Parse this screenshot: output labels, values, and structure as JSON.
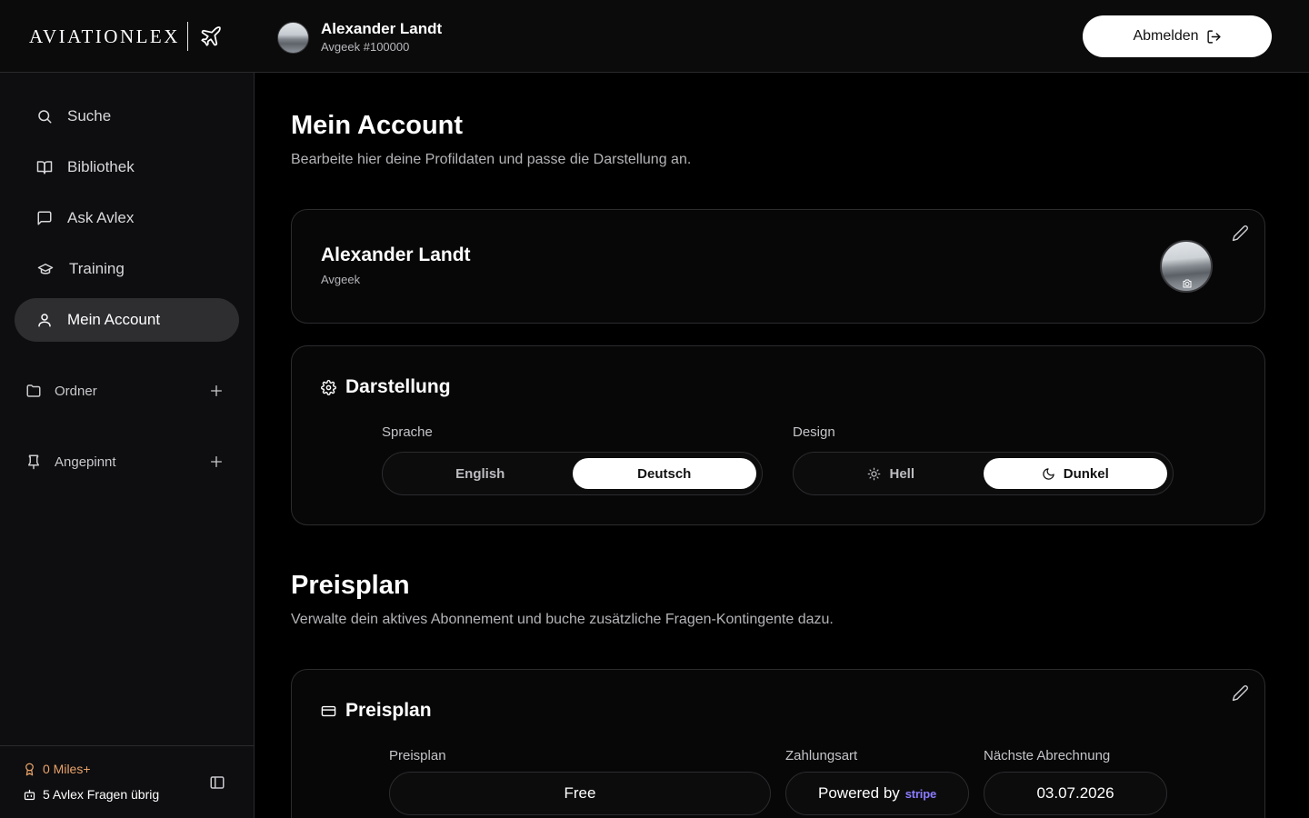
{
  "app": {
    "logo_text": "AVIATIONLEX",
    "user": {
      "name": "Alexander Landt",
      "subtitle": "Avgeek #100000"
    },
    "logout_label": "Abmelden"
  },
  "sidebar": {
    "items": [
      {
        "label": "Suche",
        "icon": "search-icon"
      },
      {
        "label": "Bibliothek",
        "icon": "book-icon"
      },
      {
        "label": "Ask Avlex",
        "icon": "chat-icon"
      },
      {
        "label": "Training",
        "icon": "graduation-cap-icon"
      },
      {
        "label": "Mein Account",
        "icon": "user-icon",
        "active": true
      }
    ],
    "sections": [
      {
        "label": "Ordner",
        "icon": "folder-icon"
      },
      {
        "label": "Angepinnt",
        "icon": "pin-icon"
      }
    ],
    "footer": {
      "miles": "0 Miles+",
      "questions": "5 Avlex Fragen übrig"
    }
  },
  "account": {
    "title": "Mein Account",
    "subtitle": "Bearbeite hier deine Profildaten und passe die Darstellung an.",
    "profile": {
      "name": "Alexander Landt",
      "role": "Avgeek"
    },
    "appearance": {
      "title": "Darstellung",
      "language_label": "Sprache",
      "language_options": [
        "English",
        "Deutsch"
      ],
      "language_selected": "Deutsch",
      "design_label": "Design",
      "design_options": [
        "Hell",
        "Dunkel"
      ],
      "design_selected": "Dunkel"
    }
  },
  "pricing": {
    "title": "Preisplan",
    "subtitle": "Verwalte dein aktives Abonnement und buche zusätzliche Fragen-Kontingente dazu.",
    "card_title": "Preisplan",
    "plan_label": "Preisplan",
    "plan_value": "Free",
    "payment_label": "Zahlungsart",
    "payment_value": "Powered by",
    "payment_brand": "stripe",
    "next_billing_label": "Nächste Abrechnung",
    "next_billing_value": "03.07.2026"
  },
  "colors": {
    "accent_miles": "#e9a36a",
    "stripe": "#8a7cff",
    "background": "#000000"
  }
}
